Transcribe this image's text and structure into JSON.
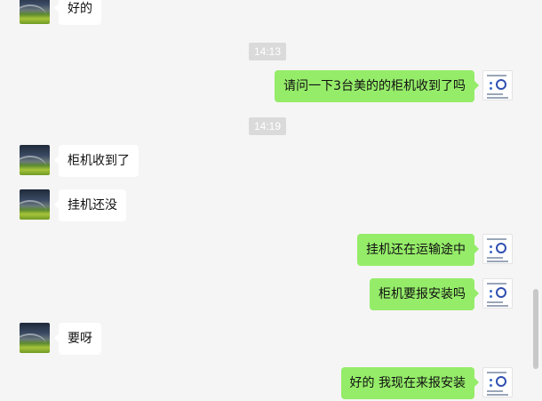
{
  "messages": [
    {
      "side": "left",
      "text": "好的"
    },
    {
      "side": "time",
      "text": "14:13"
    },
    {
      "side": "right",
      "text": "请问一下3台美的的柜机收到了吗"
    },
    {
      "side": "time",
      "text": "14:19"
    },
    {
      "side": "left",
      "text": "柜机收到了"
    },
    {
      "side": "left",
      "text": "挂机还没"
    },
    {
      "side": "right",
      "text": "挂机还在运输途中"
    },
    {
      "side": "right",
      "text": "柜机要报安装吗"
    },
    {
      "side": "left",
      "text": "要呀"
    },
    {
      "side": "right",
      "text": "好的 我现在来报安装"
    }
  ],
  "colors": {
    "background": "#f5f5f5",
    "incoming_bubble": "#ffffff",
    "outgoing_bubble": "#95ec69",
    "time_badge": "#dadada"
  }
}
